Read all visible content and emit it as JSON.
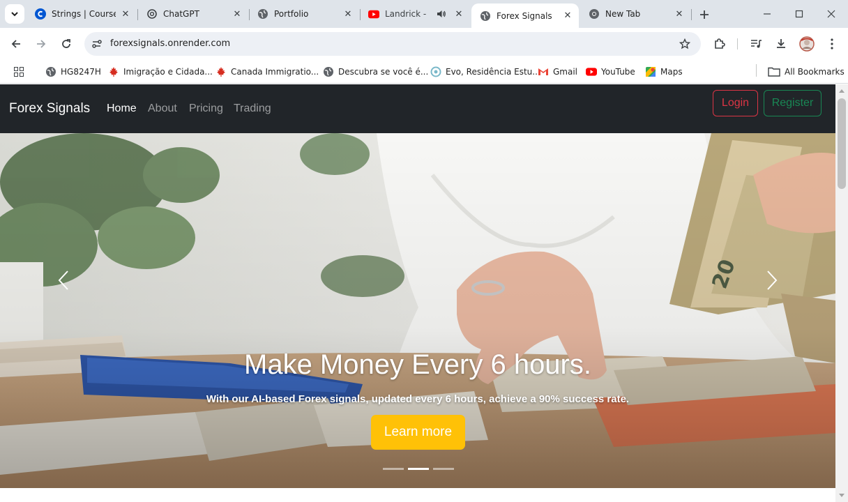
{
  "browser": {
    "tabs": [
      {
        "title": "Strings | Coursera",
        "icon": "coursera-icon"
      },
      {
        "title": "ChatGPT",
        "icon": "chatgpt-icon"
      },
      {
        "title": "Portfolio",
        "icon": "globe-icon"
      },
      {
        "title": "Landrick - Ba",
        "icon": "youtube-icon"
      },
      {
        "title": "Forex Signals",
        "icon": "globe-icon",
        "active": true
      },
      {
        "title": "New Tab",
        "icon": "chrome-icon"
      }
    ],
    "address_url": "forexsignals.onrender.com",
    "bookmarks": [
      {
        "label": "HG8247H",
        "icon": "globe-icon"
      },
      {
        "label": "Imigração e Cidada...",
        "icon": "maple-leaf-icon"
      },
      {
        "label": "Canada Immigratio...",
        "icon": "maple-leaf-icon"
      },
      {
        "label": "Descubra se você é...",
        "icon": "globe-icon"
      },
      {
        "label": "Evo, Residência Estu...",
        "icon": "evo-icon"
      },
      {
        "label": "Gmail",
        "icon": "gmail-icon"
      },
      {
        "label": "YouTube",
        "icon": "youtube-icon"
      },
      {
        "label": "Maps",
        "icon": "maps-icon"
      }
    ],
    "all_bookmarks_label": "All Bookmarks"
  },
  "site": {
    "brand": "Forex Signals",
    "nav": [
      "Home",
      "About",
      "Pricing",
      "Trading"
    ],
    "active_nav": "Home",
    "login_label": "Login",
    "register_label": "Register",
    "hero": {
      "headline": "Make Money Every 6 hours.",
      "subtext": "With our AI-based Forex signals, updated every 6 hours, achieve a 90% success rate.",
      "cta_label": "Learn more",
      "slide_count": 3,
      "active_slide": 2
    }
  },
  "colors": {
    "navbar": "#212529",
    "login": "#dc3545",
    "register": "#198754",
    "cta": "#ffc107",
    "tabstrip": "#dfe4ea"
  }
}
